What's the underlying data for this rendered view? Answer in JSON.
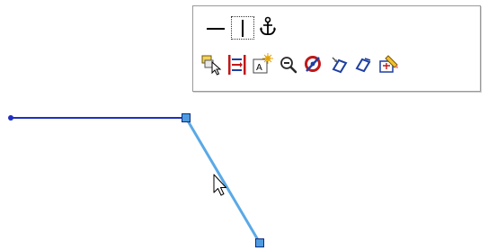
{
  "colors": {
    "background": "#ffffff",
    "line_selected": "#1f2fc0",
    "line_highlight": "#5aa9e6",
    "endpoint_fill": "#4e9be0",
    "endpoint_stroke": "#0a2a80",
    "toolbar_border": "#9a9a9a"
  },
  "toolbar": {
    "row1": [
      {
        "name": "horizontal-relation-icon"
      },
      {
        "name": "vertical-relation-icon"
      },
      {
        "name": "fix-relation-icon"
      }
    ],
    "row2": [
      {
        "name": "select-chain-icon"
      },
      {
        "name": "make-path-icon"
      },
      {
        "name": "add-dimension-icon"
      },
      {
        "name": "zoom-to-selection-icon"
      },
      {
        "name": "display-delete-relations-icon"
      },
      {
        "name": "convert-entities-icon"
      },
      {
        "name": "offset-entities-icon"
      },
      {
        "name": "edit-sketch-icon"
      }
    ]
  },
  "sketch": {
    "lines": [
      {
        "name": "horizontal-sketch-line"
      },
      {
        "name": "angled-sketch-line"
      }
    ]
  }
}
